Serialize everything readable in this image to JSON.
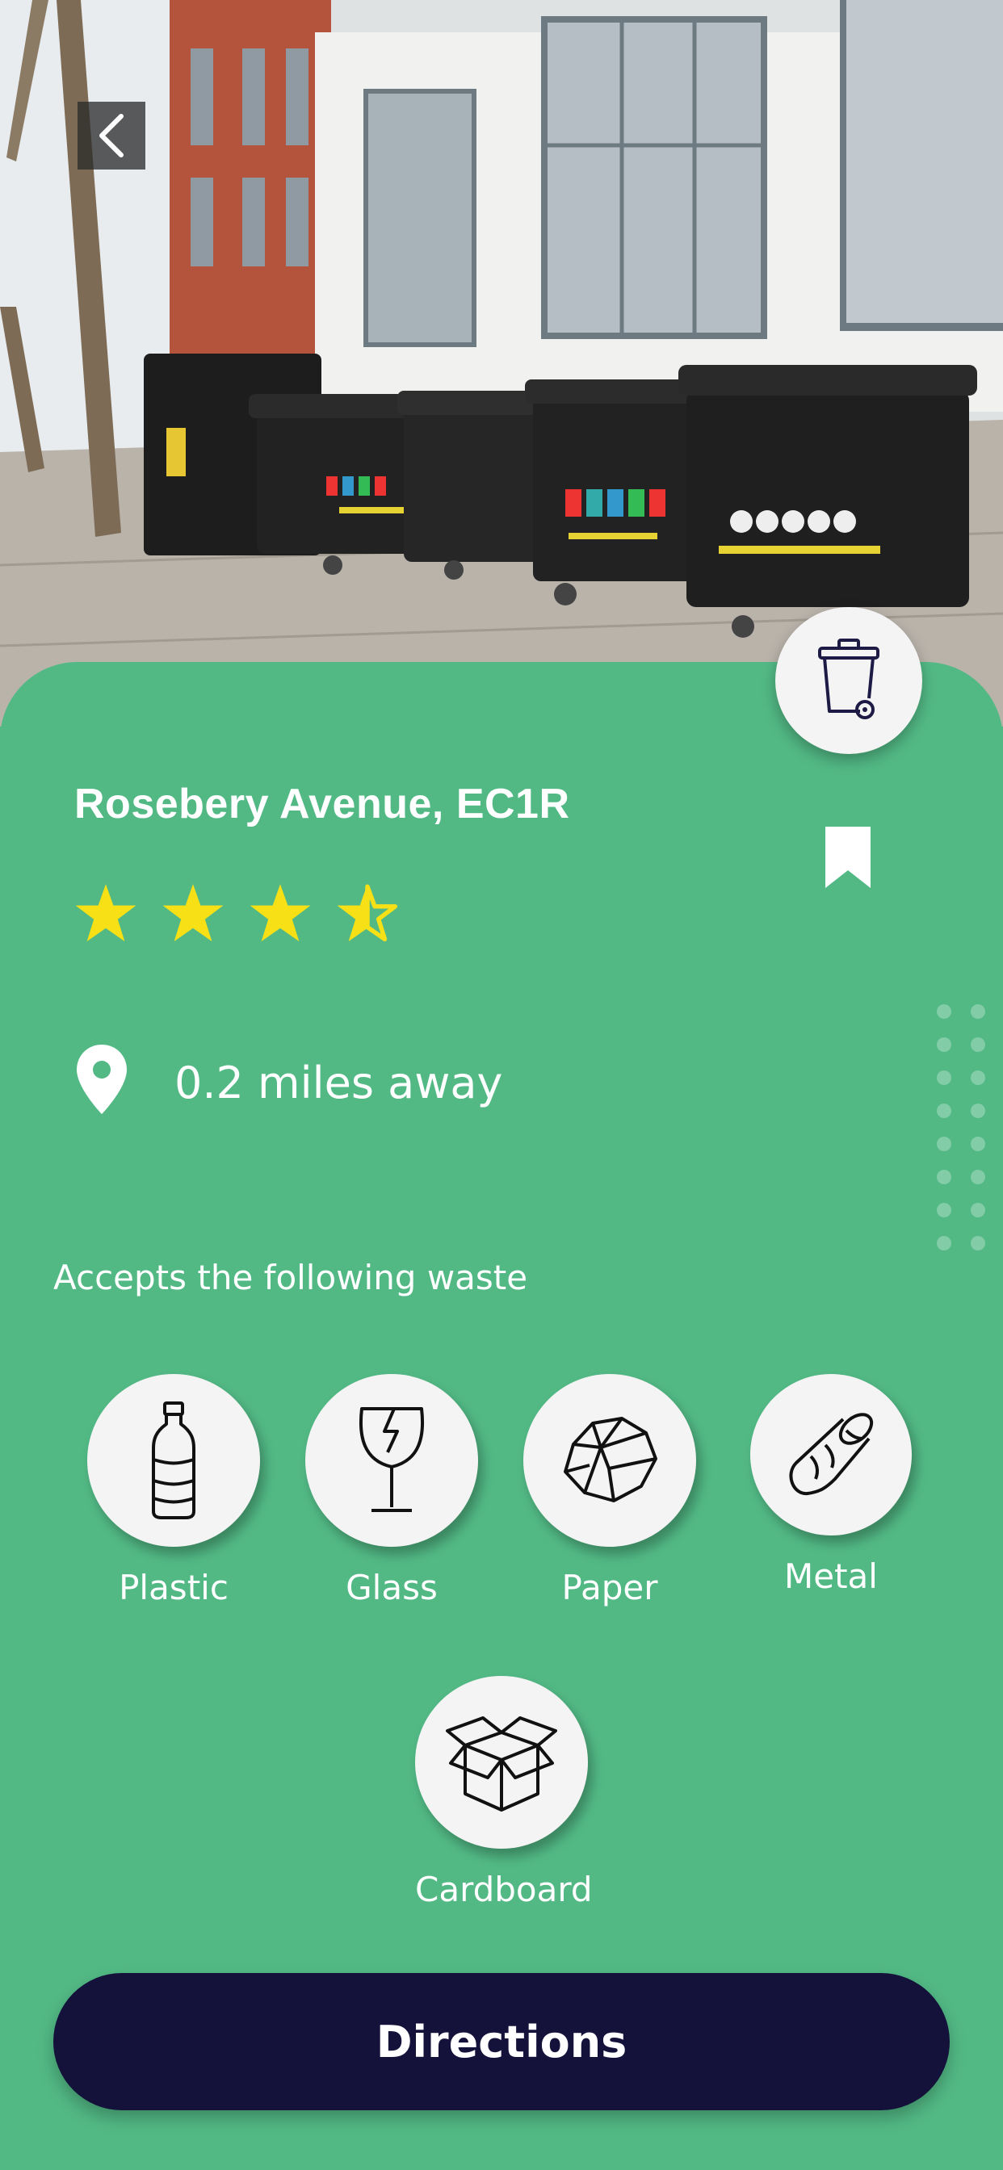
{
  "header": {
    "back_icon": "chevron-left-icon"
  },
  "location": {
    "name": "Rosebery Avenue, EC1R",
    "rating": 3.5,
    "rating_max": 5,
    "distance": "0.2 miles away",
    "badge_icon": "wheelie-bin-icon",
    "bookmark_icon": "bookmark-icon",
    "pin_icon": "map-pin-icon"
  },
  "waste": {
    "heading": "Accepts the following waste",
    "types": [
      {
        "label": "Plastic",
        "icon": "plastic-bottle-icon"
      },
      {
        "label": "Glass",
        "icon": "broken-glass-icon"
      },
      {
        "label": "Paper",
        "icon": "crumpled-paper-icon"
      },
      {
        "label": "Metal",
        "icon": "metal-can-icon"
      },
      {
        "label": "Cardboard",
        "icon": "cardboard-box-icon"
      }
    ]
  },
  "actions": {
    "directions_label": "Directions"
  },
  "colors": {
    "accent": "#52b985",
    "button": "#14113a",
    "star": "#f8e016"
  }
}
